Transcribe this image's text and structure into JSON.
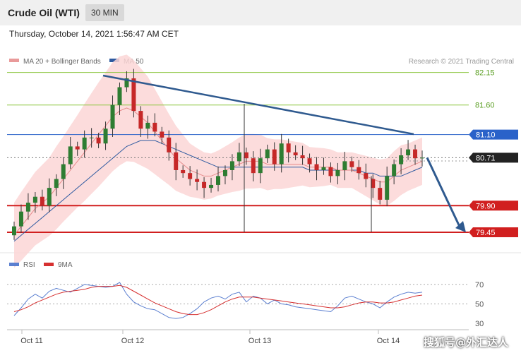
{
  "header": {
    "title": "Crude Oil (WTI)",
    "timeframe": "30 MIN",
    "datetime": "Thursday, October 14, 2021 1:56:47 AM CET"
  },
  "legend": {
    "main": [
      {
        "label": "MA 20 + Bollinger Bands",
        "color": "#e99a9a"
      },
      {
        "label": "MA 50",
        "color": "#2e5aa0"
      }
    ],
    "rsi": [
      {
        "label": "RSI",
        "color": "#5b7fd0"
      },
      {
        "label": "9MA",
        "color": "#d63030"
      }
    ]
  },
  "credit": "Research © 2021 Trading Central",
  "watermark": "搜狐号@外汇达人",
  "chart_data": [
    {
      "type": "candlestick",
      "title": "Crude Oil (WTI)",
      "timeframe": "30 MIN",
      "x_labels": [
        "Oct 11",
        "Oct 12",
        "Oct 13",
        "Oct 14"
      ],
      "ylim": [
        79.2,
        82.3
      ],
      "price_levels": [
        {
          "label": "82.15",
          "value": 82.15,
          "color": "#8cc63f",
          "style": "resistance"
        },
        {
          "label": "81.60",
          "value": 81.6,
          "color": "#8cc63f",
          "style": "resistance"
        },
        {
          "label": "81.10",
          "value": 81.1,
          "color": "#2a62c9",
          "style": "pivot"
        },
        {
          "label": "80.71",
          "value": 80.71,
          "color": "#222222",
          "style": "last"
        },
        {
          "label": "79.90",
          "value": 79.9,
          "color": "#d11f1f",
          "style": "support"
        },
        {
          "label": "79.45",
          "value": 79.45,
          "color": "#d11f1f",
          "style": "support"
        }
      ],
      "last_price": 80.71,
      "trendline": {
        "from": {
          "date": "Oct 12",
          "value": 82.15
        },
        "to": {
          "date": "Oct 14",
          "value": 80.95
        }
      },
      "forecast_arrow": {
        "from": 80.71,
        "to": 79.45,
        "direction": "down"
      },
      "series": [
        {
          "name": "Close",
          "values": [
            79.55,
            79.8,
            79.95,
            80.05,
            79.9,
            80.2,
            80.35,
            80.6,
            80.9,
            80.85,
            81.05,
            81.05,
            80.95,
            81.2,
            81.6,
            81.9,
            82.05,
            81.5,
            81.2,
            81.3,
            81.15,
            81.05,
            80.8,
            80.5,
            80.45,
            80.35,
            80.3,
            80.2,
            80.25,
            80.4,
            80.5,
            80.65,
            80.8,
            80.7,
            80.45,
            80.7,
            80.85,
            80.6,
            80.95,
            80.8,
            80.75,
            80.7,
            80.6,
            80.5,
            80.55,
            80.4,
            80.5,
            80.65,
            80.55,
            80.45,
            80.35,
            80.2,
            80.0,
            80.4,
            80.6,
            80.75,
            80.85,
            80.7,
            80.71
          ]
        },
        {
          "name": "MA 50",
          "values": [
            79.3,
            79.4,
            79.5,
            79.6,
            79.7,
            79.8,
            79.9,
            80.0,
            80.1,
            80.2,
            80.3,
            80.4,
            80.5,
            80.6,
            80.7,
            80.8,
            80.9,
            80.95,
            81.0,
            81.0,
            81.0,
            80.95,
            80.9,
            80.85,
            80.8,
            80.75,
            80.7,
            80.65,
            80.6,
            80.55,
            80.55,
            80.55,
            80.55,
            80.55,
            80.55,
            80.55,
            80.55,
            80.55,
            80.55,
            80.55,
            80.55,
            80.55,
            80.5,
            80.5,
            80.5,
            80.5,
            80.5,
            80.5,
            80.5,
            80.5,
            80.45,
            80.45,
            80.4,
            80.4,
            80.4,
            80.4,
            80.45,
            80.5,
            80.55
          ]
        },
        {
          "name": "MA 20",
          "values": [
            79.4,
            79.55,
            79.7,
            79.85,
            79.95,
            80.05,
            80.2,
            80.35,
            80.5,
            80.65,
            80.8,
            80.95,
            81.1,
            81.25,
            81.4,
            81.5,
            81.55,
            81.5,
            81.4,
            81.3,
            81.15,
            81.0,
            80.85,
            80.7,
            80.6,
            80.5,
            80.45,
            80.4,
            80.4,
            80.45,
            80.5,
            80.55,
            80.6,
            80.65,
            80.65,
            80.65,
            80.6,
            80.6,
            80.6,
            80.6,
            80.6,
            80.6,
            80.55,
            80.55,
            80.55,
            80.55,
            80.5,
            80.5,
            80.5,
            80.45,
            80.4,
            80.35,
            80.3,
            80.3,
            80.4,
            80.5,
            80.55,
            80.6,
            80.65
          ]
        }
      ]
    },
    {
      "type": "line",
      "title": "RSI",
      "yticks": [
        70,
        50,
        30
      ],
      "ylim": [
        30,
        75
      ],
      "series": [
        {
          "name": "RSI",
          "values": [
            38,
            46,
            55,
            60,
            56,
            63,
            66,
            64,
            62,
            66,
            70,
            69,
            68,
            67,
            68,
            72,
            60,
            52,
            48,
            45,
            44,
            40,
            36,
            35,
            36,
            40,
            45,
            52,
            56,
            58,
            55,
            60,
            62,
            52,
            58,
            56,
            50,
            54,
            50,
            49,
            47,
            46,
            45,
            44,
            43,
            42,
            48,
            56,
            58,
            55,
            52,
            50,
            46,
            52,
            57,
            60,
            62,
            61,
            62
          ]
        },
        {
          "name": "9MA",
          "values": [
            42,
            44,
            47,
            51,
            54,
            57,
            60,
            62,
            63,
            64,
            65,
            67,
            68,
            68,
            68,
            69,
            67,
            63,
            59,
            55,
            51,
            48,
            45,
            42,
            40,
            39,
            39,
            41,
            44,
            48,
            52,
            55,
            57,
            57,
            57,
            56,
            55,
            54,
            53,
            52,
            51,
            50,
            49,
            48,
            47,
            46,
            46,
            47,
            49,
            51,
            52,
            52,
            51,
            51,
            52,
            54,
            56,
            58,
            59
          ]
        }
      ]
    }
  ]
}
